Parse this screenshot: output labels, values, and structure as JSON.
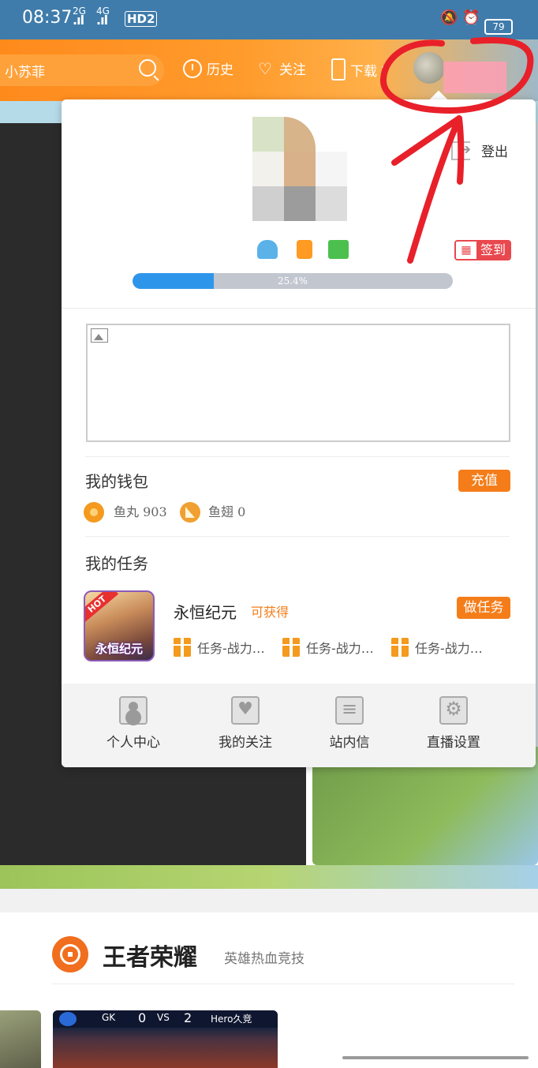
{
  "status_bar": {
    "time": "08:37",
    "sig1_label": "2G",
    "sig2_label": "4G",
    "hd_label": "HD2",
    "battery": "79"
  },
  "header": {
    "search_query": "小苏菲",
    "history_label": "历史",
    "follow_label": "关注",
    "download_label": "下载"
  },
  "profile_panel": {
    "logout_label": "登出",
    "signin_label": "签到",
    "progress_text": "25.4%",
    "progress_value": 0.254,
    "wallet_title": "我的钱包",
    "recharge_label": "充值",
    "fishball_text": "鱼丸 903",
    "fishwing_text": "鱼翅 0",
    "tasks_title": "我的任务",
    "task": {
      "icon_label": "永恒纪元",
      "hot_badge": "HOT",
      "game_name": "永恒纪元",
      "obtain_label": "可获得",
      "do_task_label": "做任务",
      "rewards": [
        "任务-战力…",
        "任务-战力…",
        "任务-战力…"
      ]
    },
    "footer": [
      {
        "label": "个人中心",
        "icon": "user-icon"
      },
      {
        "label": "我的关注",
        "icon": "heart-icon"
      },
      {
        "label": "站内信",
        "icon": "message-icon"
      },
      {
        "label": "直播设置",
        "icon": "gear-icon"
      }
    ]
  },
  "section": {
    "title": "王者荣耀",
    "subtitle": "英雄热血竞技"
  },
  "match_thumb": {
    "team_left": "GK",
    "score_left": "0",
    "vs": "VS",
    "score_right": "2",
    "team_right": "Hero久竞"
  },
  "colors": {
    "accent_orange": "#f47d1a",
    "status_bar_blue": "#3f7cab",
    "progress_blue": "#2e96ea",
    "signin_red": "#e8484e",
    "annotation_red": "#e8202a"
  }
}
